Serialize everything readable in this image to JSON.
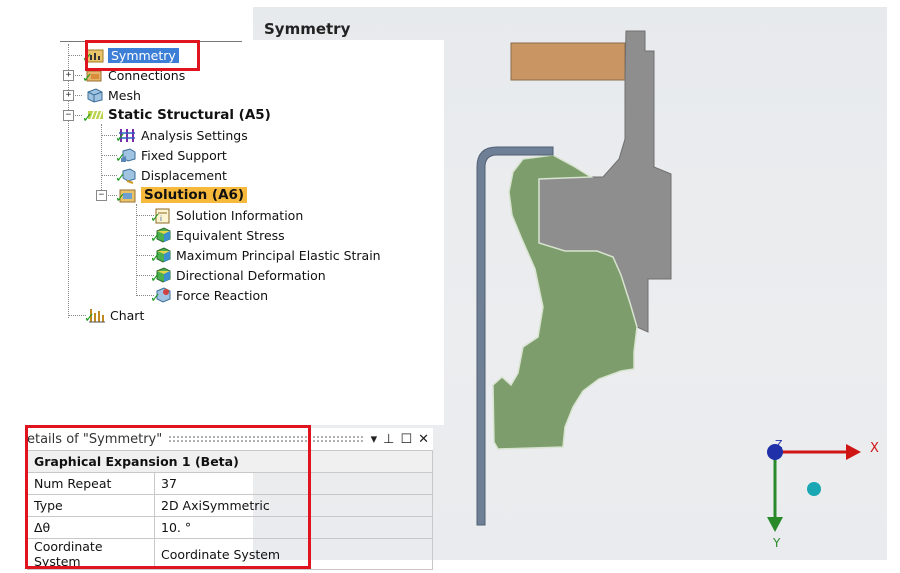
{
  "viewport": {
    "title": "Symmetry",
    "triad": {
      "x_label": "X",
      "y_label": "Y",
      "z_label": "Z"
    }
  },
  "tree": {
    "items": [
      {
        "label": "Symmetry",
        "icon": "symmetry-icon",
        "selected": true
      },
      {
        "label": "Connections",
        "icon": "connections-icon"
      },
      {
        "label": "Mesh",
        "icon": "mesh-icon"
      },
      {
        "label": "Static Structural (A5)",
        "icon": "static-structural-icon"
      },
      {
        "label": "Analysis Settings",
        "icon": "analysis-settings-icon"
      },
      {
        "label": "Fixed Support",
        "icon": "fixed-support-icon"
      },
      {
        "label": "Displacement",
        "icon": "displacement-icon"
      },
      {
        "label": "Solution (A6)",
        "icon": "solution-icon",
        "highlighted": true
      },
      {
        "label": "Solution Information",
        "icon": "solution-information-icon"
      },
      {
        "label": "Equivalent Stress",
        "icon": "result-icon"
      },
      {
        "label": "Maximum Principal Elastic Strain",
        "icon": "result-icon"
      },
      {
        "label": "Directional Deformation",
        "icon": "result-icon"
      },
      {
        "label": "Force Reaction",
        "icon": "probe-icon"
      },
      {
        "label": "Chart",
        "icon": "chart-icon"
      }
    ],
    "check_glyph": "✓"
  },
  "details": {
    "title": "etails of \"Symmetry\"",
    "group": "Graphical Expansion 1 (Beta)",
    "rows": [
      {
        "key": "Num Repeat",
        "value": "37"
      },
      {
        "key": "Type",
        "value": "2D AxiSymmetric"
      },
      {
        "key": "Δθ",
        "value": "10. °"
      },
      {
        "key": "Coordinate System",
        "value": "Coordinate System"
      }
    ]
  },
  "colors": {
    "selection": "#3d7ed6",
    "highlight": "#f7b93b",
    "annotation_red": "#e0141e",
    "part_gray": "#8e8e8e",
    "part_green": "#7d9e6c",
    "part_orange": "#c99563",
    "part_blue": "#6f7f95",
    "axis_red": "#d01515",
    "axis_green": "#2a8a2a",
    "axis_blue": "#2030a8"
  }
}
